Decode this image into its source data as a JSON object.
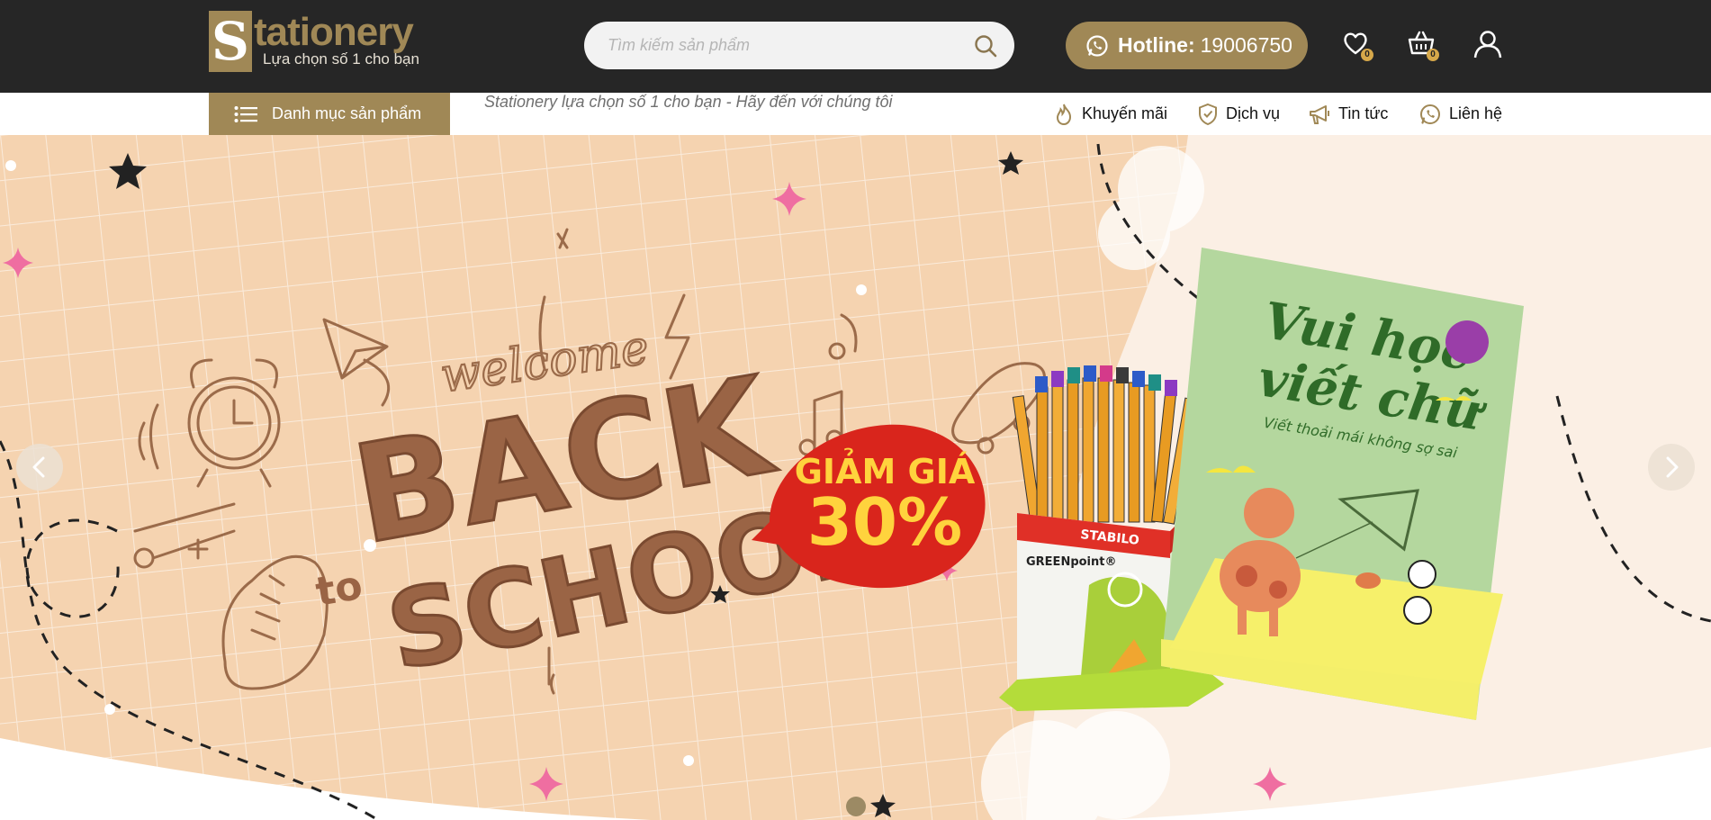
{
  "brand": {
    "logo_letter": "S",
    "logo_word": "tationery",
    "tagline": "Lựa chọn số 1 cho bạn",
    "accent_color": "#a08856",
    "topbar_color": "#262626"
  },
  "search": {
    "placeholder": "Tìm kiếm sản phẩm",
    "icon": "search-icon"
  },
  "hotline": {
    "label": "Hotline:",
    "number": "19006750",
    "icon": "whatsapp-icon"
  },
  "header_icons": {
    "wishlist": {
      "icon": "heart-icon",
      "count": "0"
    },
    "cart": {
      "icon": "basket-icon",
      "count": "0"
    },
    "account": {
      "icon": "user-icon"
    }
  },
  "nav": {
    "category_label": "Danh mục sản phẩm",
    "slogan": "Stationery lựa chọn số 1 cho bạn - Hãy đến với chúng tôi",
    "items": [
      {
        "label": "Khuyến mãi",
        "icon": "flame-icon"
      },
      {
        "label": "Dịch vụ",
        "icon": "shield-check-icon"
      },
      {
        "label": "Tin tức",
        "icon": "megaphone-icon"
      },
      {
        "label": "Liên hệ",
        "icon": "whatsapp-icon"
      }
    ]
  },
  "banner": {
    "welcome": "welcome",
    "headline_1": "BACK",
    "headline_to": "to",
    "headline_2": "SCHOOL",
    "promo_line1": "GIẢM GIÁ",
    "promo_line2": "30%",
    "book_title_1": "Vui học",
    "book_title_2": "viết chữ",
    "book_subtitle": "Viết thoải mái không sợ sai",
    "box_brand": "STABILO",
    "box_product": "GREENpoint®",
    "active_slide": 1,
    "slide_count": 1
  }
}
